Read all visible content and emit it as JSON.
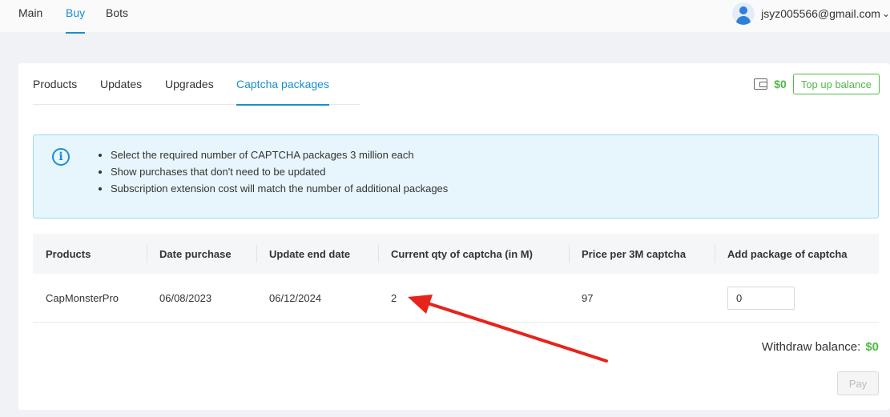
{
  "nav": {
    "items": [
      {
        "label": "Main"
      },
      {
        "label": "Buy"
      },
      {
        "label": "Bots"
      }
    ],
    "active": "Buy"
  },
  "user": {
    "email": "jsyz005566@gmail.com",
    "dropdown_glyph": "⌄"
  },
  "tabs": [
    {
      "label": "Products"
    },
    {
      "label": "Updates"
    },
    {
      "label": "Upgrades"
    },
    {
      "label": "Captcha packages"
    }
  ],
  "balance": {
    "icon": "wallet-icon",
    "amount": "$0",
    "topup_label": "Top up balance"
  },
  "info": {
    "icon": "info-icon",
    "icon_glyph": "i",
    "items": [
      "Select the required number of CAPTCHA packages 3 million each",
      "Show purchases that don't need to be updated",
      "Subscription extension cost will match the number of additional packages"
    ]
  },
  "table": {
    "headers": [
      "Products",
      "Date purchase",
      "Update end date",
      "Current qty of captcha (in M)",
      "Price per 3M captcha",
      "Add package of captcha"
    ],
    "rows": [
      {
        "product": "CapMonsterPro",
        "date_purchase": "06/08/2023",
        "update_end_date": "06/12/2024",
        "current_qty": "2",
        "price": "97",
        "add_package_value": "0"
      }
    ]
  },
  "withdraw": {
    "label": "Withdraw balance:",
    "amount": "$0"
  },
  "pay_label": "Pay",
  "colors": {
    "accent": "#1a8fcf",
    "green": "#52b848",
    "annotation_arrow": "#e8231a"
  }
}
